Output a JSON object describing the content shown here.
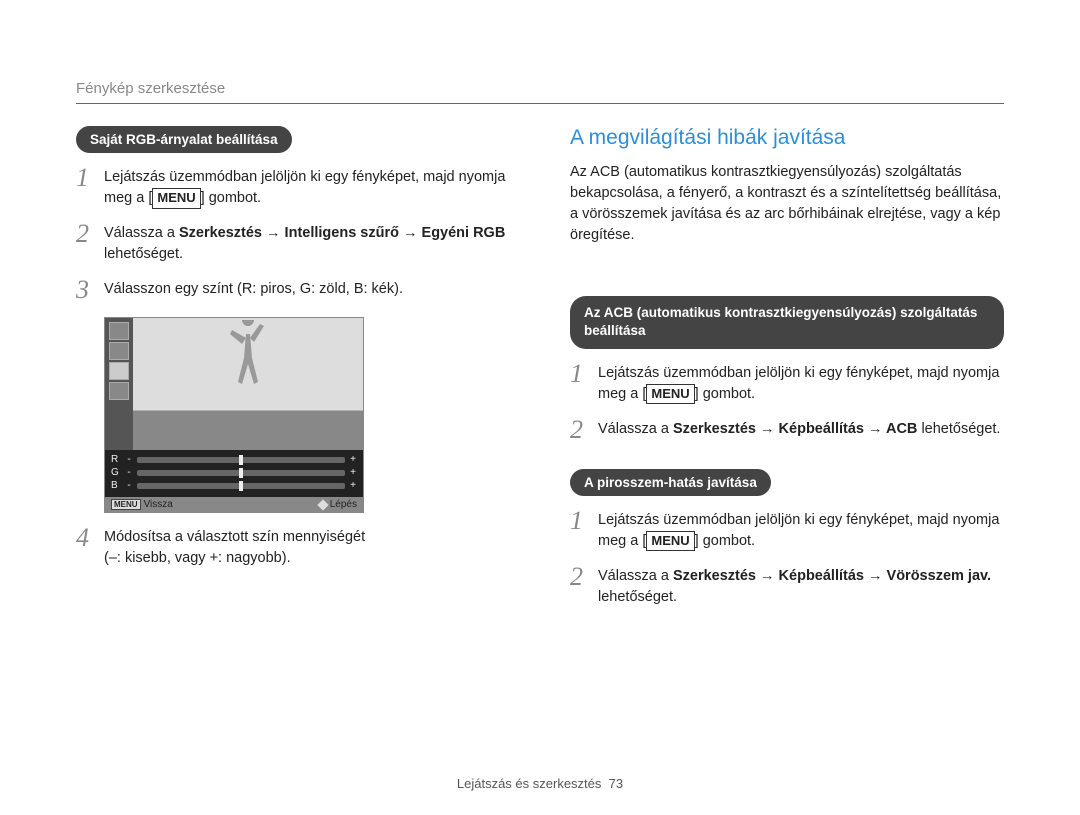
{
  "header": {
    "title": "Fénykép szerkesztése"
  },
  "left": {
    "pill": "Saját RGB-árnyalat beállítása",
    "steps": {
      "s1": {
        "num": "1",
        "pre": "Lejátszás üzemmódban jelöljön ki egy fényképet, majd nyomja meg a [",
        "menu": "MENU",
        "post": "] gombot."
      },
      "s2": {
        "num": "2",
        "a": "Válassza a ",
        "b": "Szerkesztés → Intelligens szűrő → Egyéni RGB",
        "c": " lehetőséget."
      },
      "s3": {
        "num": "3",
        "text": "Válasszon egy színt (R: piros, G: zöld, B: kék)."
      },
      "s4": {
        "num": "4",
        "line1": "Módosítsa a választott szín mennyiségét",
        "line2": "(–: kisebb, vagy +: nagyobb)."
      }
    },
    "mock": {
      "sliders": {
        "r": "R",
        "g": "G",
        "b": "B",
        "minus": "-",
        "plus": "+"
      },
      "footer": {
        "back_label": "Vissza",
        "move_label": "Lépés",
        "menu": "MENU"
      }
    }
  },
  "right": {
    "heading": "A megvilágítási hibák javítása",
    "intro": "Az ACB (automatikus kontrasztkiegyensúlyozás) szolgáltatás bekapcsolása, a fényerő, a kontraszt és a színtelítettség beállítása, a vörösszemek javítása és az arc bőrhibáinak elrejtése, vagy a kép öregítése.",
    "acb": {
      "pill": "Az ACB (automatikus kontrasztkiegyensúlyozás) szolgáltatás beállítása",
      "s1": {
        "num": "1",
        "pre": "Lejátszás üzemmódban jelöljön ki egy fényképet, majd nyomja meg a [",
        "menu": "MENU",
        "post": "] gombot."
      },
      "s2": {
        "num": "2",
        "a": "Válassza a ",
        "b": "Szerkesztés → Képbeállítás → ACB",
        "c": " lehetőséget."
      }
    },
    "redeye": {
      "pill": "A pirosszem-hatás javítása",
      "s1": {
        "num": "1",
        "pre": "Lejátszás üzemmódban jelöljön ki egy fényképet, majd nyomja meg a [",
        "menu": "MENU",
        "post": "] gombot."
      },
      "s2": {
        "num": "2",
        "a": "Válassza a ",
        "b": "Szerkesztés → Képbeállítás → Vörösszem jav.",
        "c": " lehetőséget."
      }
    }
  },
  "footer": {
    "chapter": "Lejátszás és szerkesztés",
    "page": "73"
  }
}
